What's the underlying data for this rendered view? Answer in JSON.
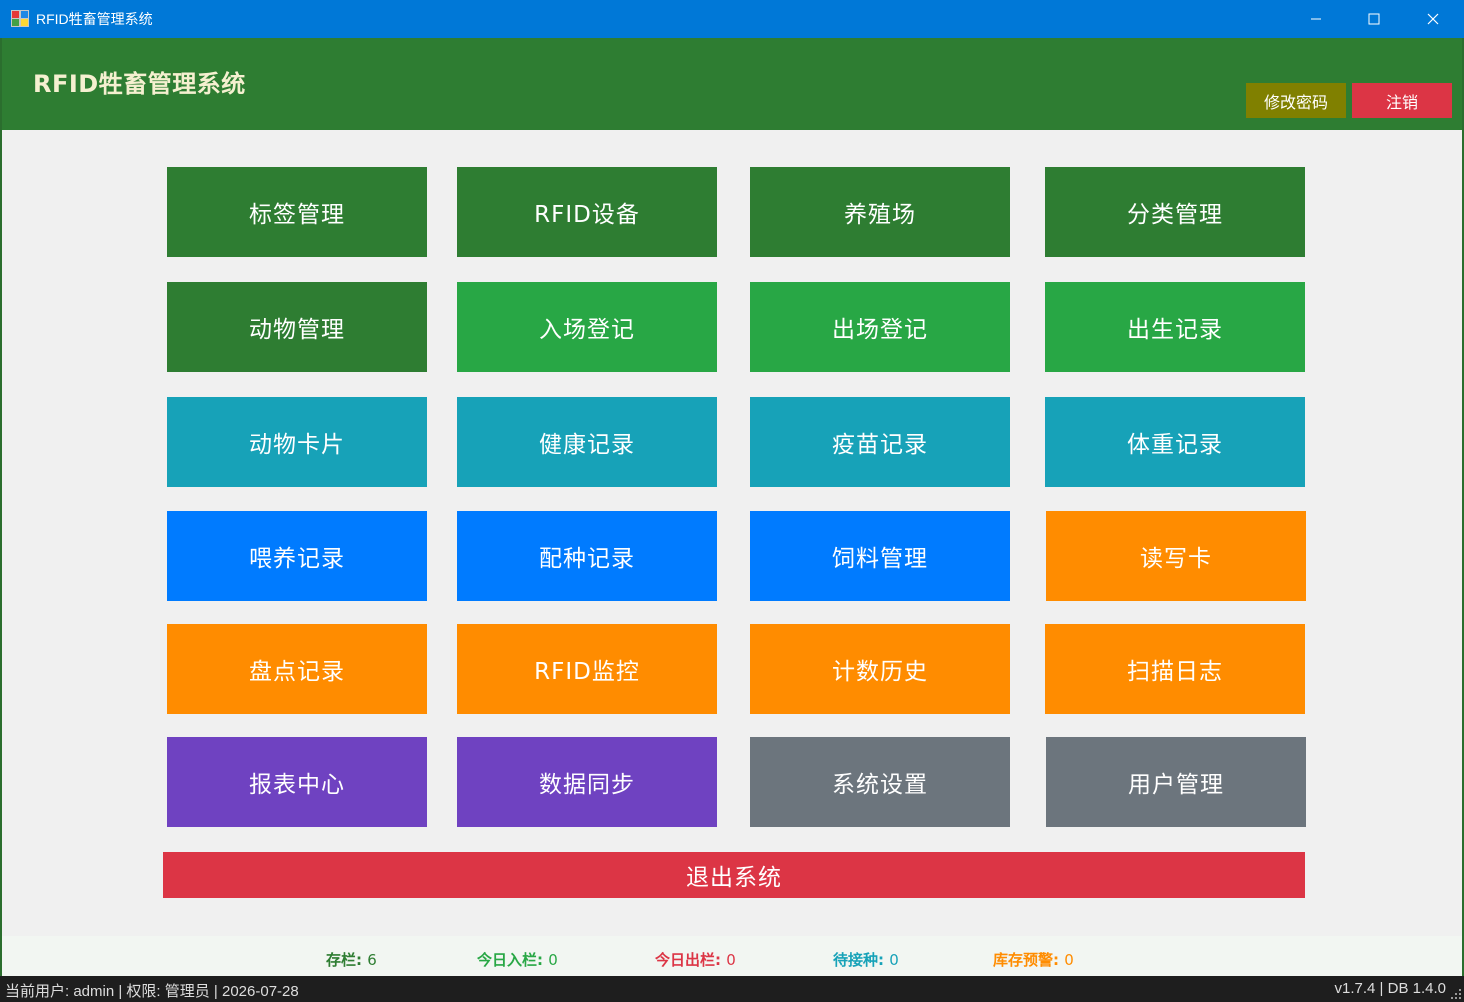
{
  "window": {
    "title": "RFID牲畜管理系统"
  },
  "header": {
    "app_title": "RFID牲畜管理系统",
    "change_password": "修改密码",
    "logout": "注销"
  },
  "tiles": [
    [
      "标签管理",
      "RFID设备",
      "养殖场",
      "分类管理"
    ],
    [
      "动物管理",
      "入场登记",
      "出场登记",
      "出生记录"
    ],
    [
      "动物卡片",
      "健康记录",
      "疫苗记录",
      "体重记录"
    ],
    [
      "喂养记录",
      "配种记录",
      "饲料管理",
      "读写卡"
    ],
    [
      "盘点记录",
      "RFID监控",
      "计数历史",
      "扫描日志"
    ],
    [
      "报表中心",
      "数据同步",
      "系统设置",
      "用户管理"
    ]
  ],
  "exit_label": "退出系统",
  "stats": {
    "inventory_label": "存栏:",
    "inventory_value": "6",
    "today_in_label": "今日入栏:",
    "today_in_value": "0",
    "today_out_label": "今日出栏:",
    "today_out_value": "0",
    "pending_breeding_label": "待接种:",
    "pending_breeding_value": "0",
    "stock_alert_label": "库存预警:",
    "stock_alert_value": "0"
  },
  "statusbar": {
    "left": "当前用户: admin | 权限: 管理员 | 2026-07-28",
    "right": "v1.7.4 | DB 1.4.0"
  },
  "colors": {
    "header_green": "#2e7d32",
    "success_green": "#28a745",
    "teal": "#17a2b8",
    "blue": "#007bff",
    "orange": "#ff8c00",
    "purple": "#6f42c1",
    "gray": "#6c757d",
    "danger_red": "#dc3545",
    "olive": "#808000"
  }
}
